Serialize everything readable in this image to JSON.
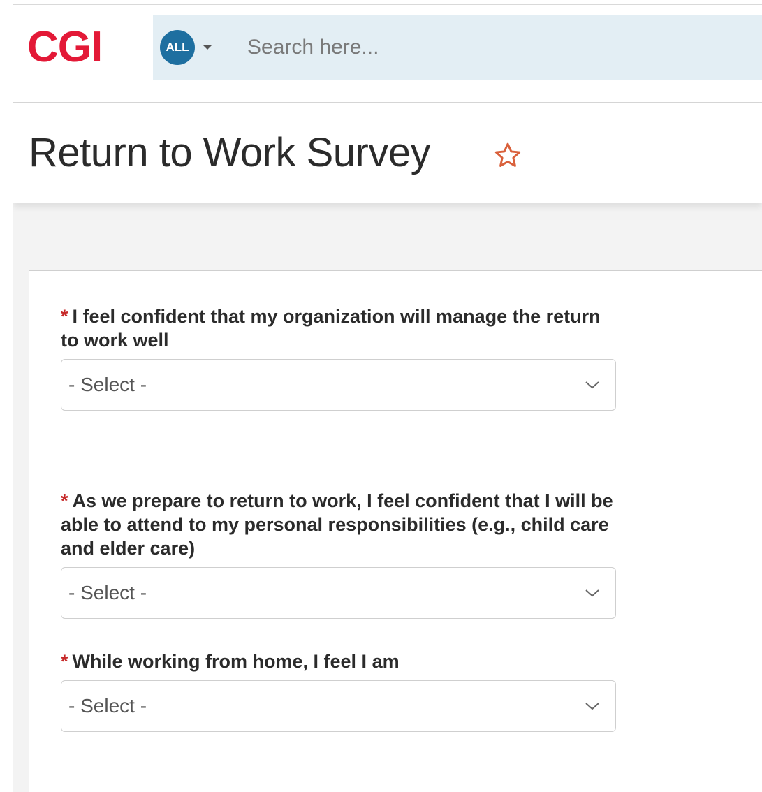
{
  "header": {
    "logo": "CGI",
    "search_scope": "ALL",
    "search_placeholder": "Search here..."
  },
  "page": {
    "title": "Return to Work Survey"
  },
  "form": {
    "required_marker": "*",
    "questions": [
      {
        "label": "I feel confident that my organization will manage the return to work well",
        "value": "- Select -"
      },
      {
        "label": "As we prepare to return to work, I feel confident that I will be able to attend to my personal responsibilities (e.g., child care and elder care)",
        "value": "- Select -"
      },
      {
        "label": "While working from home, I feel I am",
        "value": "- Select -"
      }
    ]
  },
  "colors": {
    "brand": "#e31937",
    "scope_badge": "#1e6fa0",
    "search_bg": "#e3eef4",
    "required": "#c62828",
    "star": "#d9603b"
  },
  "icons": [
    "chevron-down-icon",
    "star-outline-icon",
    "caret-down-icon"
  ]
}
